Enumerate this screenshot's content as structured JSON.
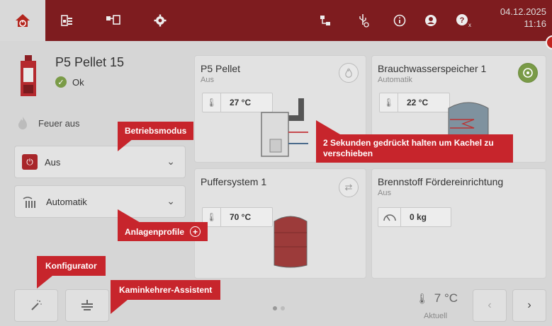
{
  "topbar": {
    "date": "04.12.2025",
    "time": "11:16",
    "icons": [
      "home-icon",
      "heating-icon",
      "network-icon",
      "settings-icon",
      "lan-icon",
      "usb-icon",
      "info-icon",
      "account-icon",
      "help-icon"
    ]
  },
  "device": {
    "name": "P5 Pellet 15",
    "status": "Ok",
    "fire_status": "Feuer aus"
  },
  "operation_mode": {
    "value": "Aus"
  },
  "profile": {
    "value": "Automatik"
  },
  "tiles": {
    "pellet": {
      "title": "P5 Pellet",
      "subtitle": "Aus",
      "temp": "27 °C"
    },
    "hot_water": {
      "title": "Brauchwasserspeicher 1",
      "subtitle": "Automatik",
      "temp": "22 °C"
    },
    "buffer": {
      "title": "Puffersystem 1",
      "temp": "70 °C"
    },
    "fuel": {
      "title": "Brennstoff Fördereinrichtung",
      "subtitle": "Aus",
      "amount": "0 kg"
    }
  },
  "callouts": {
    "betriebsmodus": "Betriebsmodus",
    "drag_hint": "2 Sekunden gedrückt halten um Kachel zu verschieben",
    "anlagenprofile": "Anlagenprofile",
    "konfigurator": "Konfigurator",
    "kaminkehrer": "Kaminkehrer-Assistent"
  },
  "outside_temp": {
    "value": "7 °C",
    "label": "Aktuell"
  },
  "nav": {
    "prev": "‹",
    "next": "›"
  },
  "colors": {
    "brand": "#7e1c1f",
    "callout": "#c7252c",
    "ok": "#7a9b47"
  }
}
